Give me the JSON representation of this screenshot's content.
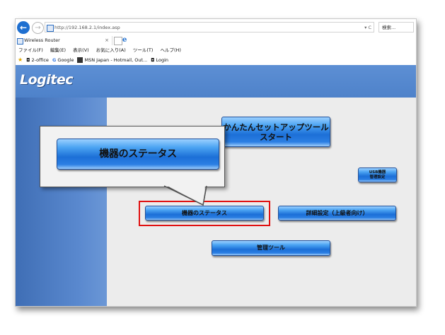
{
  "browser": {
    "url": "http://192.168.2.1/index.asp",
    "url_tools": "▾ C",
    "search_placeholder": "検索...",
    "tab_title": "Wireless Router",
    "tab_close": "×",
    "menu": [
      "ファイル(F)",
      "編集(E)",
      "表示(V)",
      "お気に入り(A)",
      "ツール(T)",
      "ヘルプ(H)"
    ],
    "favorites": [
      "2-office",
      "Google",
      "MSN Japan - Hotmail, Out...",
      "Login"
    ]
  },
  "page": {
    "logo": "Logitec",
    "buttons": {
      "easy_setup_line1": "かんたんセットアップツール",
      "easy_setup_line2": "スタート",
      "usb_line1": "USB機器",
      "usb_line2": "管理設定",
      "device_status": "機器のステータス",
      "advanced": "詳細設定（上級者向け）",
      "management": "管理ツール"
    }
  },
  "callout": {
    "label": "機器のステータス"
  },
  "colors": {
    "highlight": "#e01010",
    "page_blue": "#4f7fc4",
    "button_blue": "#1c6fd7"
  }
}
